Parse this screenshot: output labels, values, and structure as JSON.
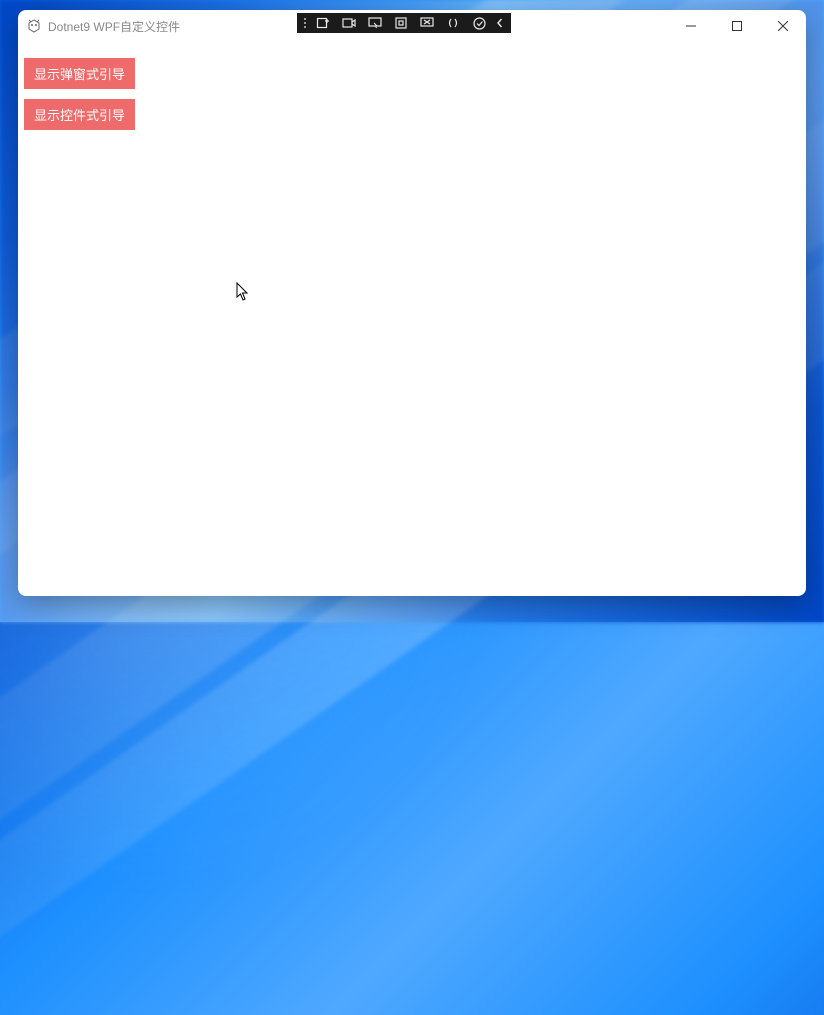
{
  "window": {
    "title": "Dotnet9 WPF自定义控件"
  },
  "buttons": {
    "popup_guide": "显示弹窗式引导",
    "control_guide": "显示控件式引导"
  },
  "colors": {
    "button_bg": "#ef6b6b",
    "window_bg": "#ffffff"
  }
}
